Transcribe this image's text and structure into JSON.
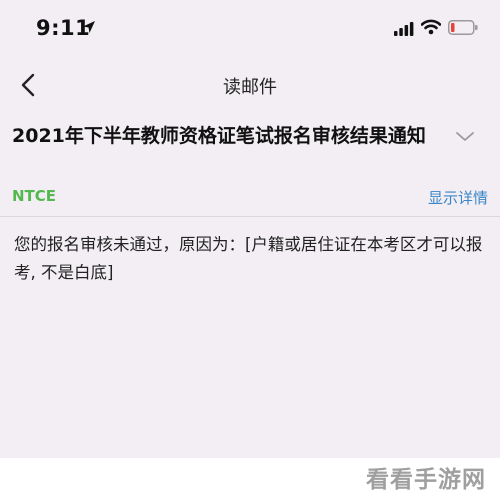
{
  "status_bar": {
    "time": "9:11",
    "icons": [
      "location-arrow-icon",
      "signal-icon",
      "wifi-icon",
      "battery-low-icon"
    ],
    "battery_color": "#e6423a"
  },
  "nav": {
    "back_icon": "chevron-left-icon",
    "title": "读邮件"
  },
  "email": {
    "subject": "2021年下半年教师资格证笔试报名审核结果通知",
    "expand_icon": "chevron-down-icon",
    "sender": "NTCE",
    "detail_link": "显示详情",
    "body": "您的报名审核未通过，原因为：[户籍或居住证在本考区才可以报考, 不是白底]"
  },
  "watermark": "看看手游网",
  "colors": {
    "sender": "#52b94e",
    "link": "#3a86c8",
    "background": "#f2eef3"
  }
}
